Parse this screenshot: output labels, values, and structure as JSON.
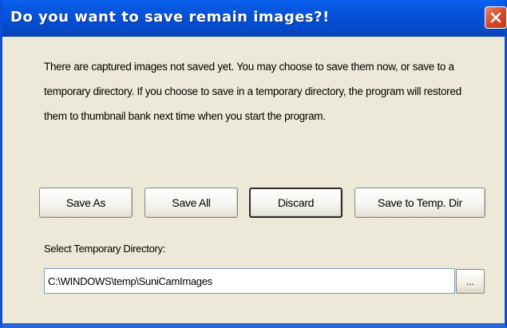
{
  "window": {
    "title": "Do you want to save remain images?!"
  },
  "message": {
    "text": "There are captured images not saved yet. You may choose to save them now, or save to a temporary directory. If you choose to save in a temporary directory, the program will restored them to thumbnail bank next time when you start the program."
  },
  "buttons": {
    "save_as": "Save As",
    "save_all": "Save All",
    "discard": "Discard",
    "save_temp": "Save to Temp. Dir"
  },
  "temp_dir": {
    "label": "Select Temporary Directory:",
    "value": "C:\\WINDOWS\\temp\\SuniCamImages",
    "browse_label": "..."
  },
  "icons": {
    "close": "close-icon"
  },
  "colors": {
    "titlebar": "#0550d8",
    "close_button": "#d8492a",
    "dialog_background": "#ece9d8"
  }
}
